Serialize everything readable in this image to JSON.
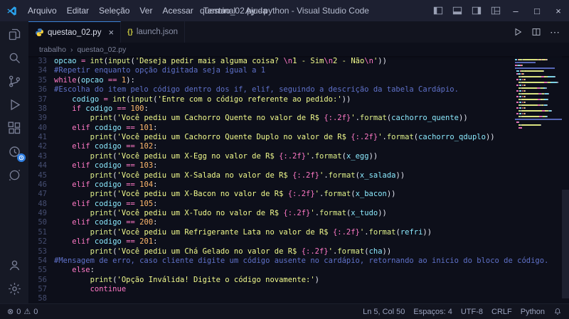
{
  "window": {
    "title": "questao_02.py - python - Visual Studio Code"
  },
  "menu": {
    "items": [
      "Arquivo",
      "Editar",
      "Seleção",
      "Ver",
      "Acessar",
      "Terminal",
      "Ajuda"
    ]
  },
  "window_controls": {
    "minimize": "–",
    "maximize": "□",
    "close": "×"
  },
  "icons": {
    "close_tab": "×",
    "more_actions": "⋯",
    "error": "⊗",
    "warning": "⚠",
    "json_braces": "{}"
  },
  "tabs": [
    {
      "label": "questao_02.py",
      "icon": "python",
      "active": true
    },
    {
      "label": "launch.json",
      "icon": "json",
      "active": false
    }
  ],
  "breadcrumb": {
    "folder": "trabalho",
    "separator": "›",
    "file": "questao_02.py"
  },
  "editor": {
    "first_line": 33,
    "lines": [
      [
        [
          "v",
          "opcao"
        ],
        [
          "d",
          " "
        ],
        [
          "o",
          "="
        ],
        [
          "d",
          " "
        ],
        [
          "f",
          "int"
        ],
        [
          "d",
          "("
        ],
        [
          "f",
          "input"
        ],
        [
          "d",
          "("
        ],
        [
          "s",
          "'Deseja pedir mais alguma coisa? "
        ],
        [
          "e",
          "\\n"
        ],
        [
          "s",
          "1 - Sim"
        ],
        [
          "e",
          "\\n"
        ],
        [
          "s",
          "2 - Não"
        ],
        [
          "e",
          "\\n"
        ],
        [
          "s",
          "'"
        ],
        [
          "d",
          "))"
        ]
      ],
      [
        [
          "c",
          "#Repetir enquanto opção digitada seja igual a 1"
        ]
      ],
      [
        [
          "k",
          "while"
        ],
        [
          "d",
          "("
        ],
        [
          "v",
          "opcao"
        ],
        [
          "d",
          " "
        ],
        [
          "o",
          "=="
        ],
        [
          "d",
          " "
        ],
        [
          "n",
          "1"
        ],
        [
          "d",
          "):"
        ]
      ],
      [
        [
          "c",
          "#Escolha do item pelo código dentro dos if, elif, seguindo a descrição da tabela Cardápio."
        ]
      ],
      [
        [
          "d",
          "    "
        ],
        [
          "v",
          "codigo"
        ],
        [
          "d",
          " "
        ],
        [
          "o",
          "="
        ],
        [
          "d",
          " "
        ],
        [
          "f",
          "int"
        ],
        [
          "d",
          "("
        ],
        [
          "f",
          "input"
        ],
        [
          "d",
          "("
        ],
        [
          "s",
          "'Entre com o código referente ao pedido:'"
        ],
        [
          "d",
          "))"
        ]
      ],
      [
        [
          "d",
          "    "
        ],
        [
          "k",
          "if"
        ],
        [
          "d",
          " "
        ],
        [
          "v",
          "codigo"
        ],
        [
          "d",
          " "
        ],
        [
          "o",
          "=="
        ],
        [
          "d",
          " "
        ],
        [
          "n",
          "100"
        ],
        [
          "d",
          ":"
        ]
      ],
      [
        [
          "d",
          "        "
        ],
        [
          "f",
          "print"
        ],
        [
          "d",
          "("
        ],
        [
          "s",
          "'Você pediu um Cachorro Quente no valor de R$ "
        ],
        [
          "e",
          "{:.2f}"
        ],
        [
          "s",
          "'"
        ],
        [
          "d",
          "."
        ],
        [
          "f",
          "format"
        ],
        [
          "d",
          "("
        ],
        [
          "v",
          "cachorro_quente"
        ],
        [
          "d",
          "))"
        ]
      ],
      [
        [
          "d",
          "    "
        ],
        [
          "k",
          "elif"
        ],
        [
          "d",
          " "
        ],
        [
          "v",
          "codigo"
        ],
        [
          "d",
          " "
        ],
        [
          "o",
          "=="
        ],
        [
          "d",
          " "
        ],
        [
          "n",
          "101"
        ],
        [
          "d",
          ":"
        ]
      ],
      [
        [
          "d",
          "        "
        ],
        [
          "f",
          "print"
        ],
        [
          "d",
          "("
        ],
        [
          "s",
          "'Você pediu um Cachorro Quente Duplo no valor de R$ "
        ],
        [
          "e",
          "{:.2f}"
        ],
        [
          "s",
          "'"
        ],
        [
          "d",
          "."
        ],
        [
          "f",
          "format"
        ],
        [
          "d",
          "("
        ],
        [
          "v",
          "cachorro_qduplo"
        ],
        [
          "d",
          "))"
        ]
      ],
      [
        [
          "d",
          "    "
        ],
        [
          "k",
          "elif"
        ],
        [
          "d",
          " "
        ],
        [
          "v",
          "codigo"
        ],
        [
          "d",
          " "
        ],
        [
          "o",
          "=="
        ],
        [
          "d",
          " "
        ],
        [
          "n",
          "102"
        ],
        [
          "d",
          ":"
        ]
      ],
      [
        [
          "d",
          "        "
        ],
        [
          "f",
          "print"
        ],
        [
          "d",
          "("
        ],
        [
          "s",
          "'Você pediu um X-Egg no valor de R$ "
        ],
        [
          "e",
          "{:.2f}"
        ],
        [
          "s",
          "'"
        ],
        [
          "d",
          "."
        ],
        [
          "f",
          "format"
        ],
        [
          "d",
          "("
        ],
        [
          "v",
          "x_egg"
        ],
        [
          "d",
          "))"
        ]
      ],
      [
        [
          "d",
          "    "
        ],
        [
          "k",
          "elif"
        ],
        [
          "d",
          " "
        ],
        [
          "v",
          "codigo"
        ],
        [
          "d",
          " "
        ],
        [
          "o",
          "=="
        ],
        [
          "d",
          " "
        ],
        [
          "n",
          "103"
        ],
        [
          "d",
          ":"
        ]
      ],
      [
        [
          "d",
          "        "
        ],
        [
          "f",
          "print"
        ],
        [
          "d",
          "("
        ],
        [
          "s",
          "'Você pediu um X-Salada no valor de R$ "
        ],
        [
          "e",
          "{:.2f}"
        ],
        [
          "s",
          "'"
        ],
        [
          "d",
          "."
        ],
        [
          "f",
          "format"
        ],
        [
          "d",
          "("
        ],
        [
          "v",
          "x_salada"
        ],
        [
          "d",
          "))"
        ]
      ],
      [
        [
          "d",
          "    "
        ],
        [
          "k",
          "elif"
        ],
        [
          "d",
          " "
        ],
        [
          "v",
          "codigo"
        ],
        [
          "d",
          " "
        ],
        [
          "o",
          "=="
        ],
        [
          "d",
          " "
        ],
        [
          "n",
          "104"
        ],
        [
          "d",
          ":"
        ]
      ],
      [
        [
          "d",
          "        "
        ],
        [
          "f",
          "print"
        ],
        [
          "d",
          "("
        ],
        [
          "s",
          "'Você pediu um X-Bacon no valor de R$ "
        ],
        [
          "e",
          "{:.2f}"
        ],
        [
          "s",
          "'"
        ],
        [
          "d",
          "."
        ],
        [
          "f",
          "format"
        ],
        [
          "d",
          "("
        ],
        [
          "v",
          "x_bacon"
        ],
        [
          "d",
          "))"
        ]
      ],
      [
        [
          "d",
          "    "
        ],
        [
          "k",
          "elif"
        ],
        [
          "d",
          " "
        ],
        [
          "v",
          "codigo"
        ],
        [
          "d",
          " "
        ],
        [
          "o",
          "=="
        ],
        [
          "d",
          " "
        ],
        [
          "n",
          "105"
        ],
        [
          "d",
          ":"
        ]
      ],
      [
        [
          "d",
          "        "
        ],
        [
          "f",
          "print"
        ],
        [
          "d",
          "("
        ],
        [
          "s",
          "'Você pediu um X-Tudo no valor de R$ "
        ],
        [
          "e",
          "{:.2f}"
        ],
        [
          "s",
          "'"
        ],
        [
          "d",
          "."
        ],
        [
          "f",
          "format"
        ],
        [
          "d",
          "("
        ],
        [
          "v",
          "x_tudo"
        ],
        [
          "d",
          "))"
        ]
      ],
      [
        [
          "d",
          "    "
        ],
        [
          "k",
          "elif"
        ],
        [
          "d",
          " "
        ],
        [
          "v",
          "codigo"
        ],
        [
          "d",
          " "
        ],
        [
          "o",
          "=="
        ],
        [
          "d",
          " "
        ],
        [
          "n",
          "200"
        ],
        [
          "d",
          ":"
        ]
      ],
      [
        [
          "d",
          "        "
        ],
        [
          "f",
          "print"
        ],
        [
          "d",
          "("
        ],
        [
          "s",
          "'Você pediu um Refrigerante Lata no valor de R$ "
        ],
        [
          "e",
          "{:.2f}"
        ],
        [
          "s",
          "'"
        ],
        [
          "d",
          "."
        ],
        [
          "f",
          "format"
        ],
        [
          "d",
          "("
        ],
        [
          "v",
          "refri"
        ],
        [
          "d",
          "))"
        ]
      ],
      [
        [
          "d",
          "    "
        ],
        [
          "k",
          "elif"
        ],
        [
          "d",
          " "
        ],
        [
          "v",
          "codigo"
        ],
        [
          "d",
          " "
        ],
        [
          "o",
          "=="
        ],
        [
          "d",
          " "
        ],
        [
          "n",
          "201"
        ],
        [
          "d",
          ":"
        ]
      ],
      [
        [
          "d",
          "        "
        ],
        [
          "f",
          "print"
        ],
        [
          "d",
          "("
        ],
        [
          "s",
          "'Você pediu um Chá Gelado no valor de R$ "
        ],
        [
          "e",
          "{:.2f}"
        ],
        [
          "s",
          "'"
        ],
        [
          "d",
          "."
        ],
        [
          "f",
          "format"
        ],
        [
          "d",
          "("
        ],
        [
          "v",
          "cha"
        ],
        [
          "d",
          "))"
        ]
      ],
      [
        [
          "c",
          "#Mensagem de erro, caso cliente digite um código ausente no cardápio, retornando ao inicio do bloco de código."
        ]
      ],
      [
        [
          "d",
          "    "
        ],
        [
          "k",
          "else"
        ],
        [
          "d",
          ":"
        ]
      ],
      [
        [
          "d",
          "        "
        ],
        [
          "f",
          "print"
        ],
        [
          "d",
          "("
        ],
        [
          "s",
          "'Opção Inválida! Digite o código novamente:'"
        ],
        [
          "d",
          ")"
        ]
      ],
      [
        [
          "d",
          "        "
        ],
        [
          "k",
          "continue"
        ]
      ],
      []
    ]
  },
  "status_bar": {
    "errors": "0",
    "warnings": "0",
    "cursor": "Ln 5, Col 50",
    "indent": "Espaços: 4",
    "encoding": "UTF-8",
    "eol": "CRLF",
    "language": "Python"
  },
  "colors": {
    "accent": "#0a79cf",
    "badge": "#2e7de0",
    "editor_bg": "#0d0f1a",
    "titlebar_bg": "#1d2031",
    "keyword": "#ff79c6",
    "string": "#f1fa8c",
    "function": "#dff08a",
    "variable": "#8be9fd",
    "number": "#ffb86c",
    "comment": "#5f71c9"
  }
}
